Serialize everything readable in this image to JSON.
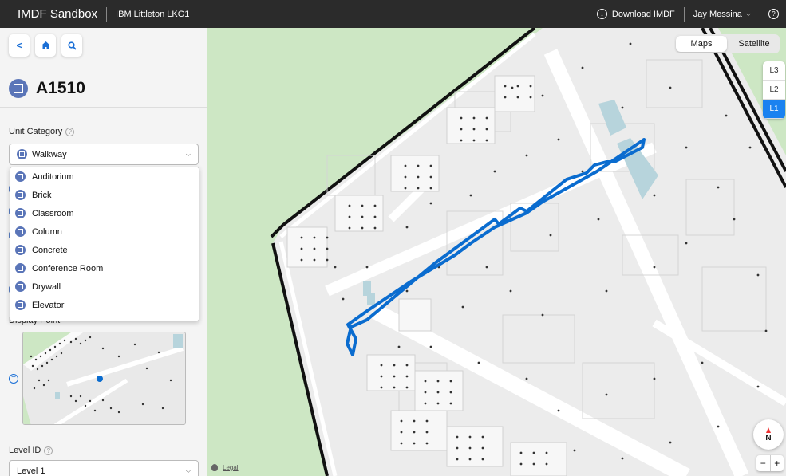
{
  "topbar": {
    "app_title": "IMDF Sandbox",
    "venue": "IBM Littleton LKG1",
    "download_label": "Download IMDF",
    "user_name": "Jay Messina",
    "help_glyph": "?"
  },
  "sidebar": {
    "unit_name": "A1510",
    "unit_category_label": "Unit Category",
    "unit_category_value": "Walkway",
    "categories": [
      "Auditorium",
      "Brick",
      "Classroom",
      "Column",
      "Concrete",
      "Conference Room",
      "Drywall",
      "Elevator"
    ],
    "display_point_label": "Display Point",
    "level_id_label": "Level ID",
    "level_value": "Level 1"
  },
  "map": {
    "view_modes": [
      "Maps",
      "Satellite"
    ],
    "active_view": "Maps",
    "levels": [
      "L3",
      "L2",
      "L1"
    ],
    "active_level": "L1",
    "compass_label": "N",
    "zoom_out": "−",
    "zoom_in": "+",
    "legal_label": "Legal"
  },
  "colors": {
    "accent": "#1a82f0",
    "selection": "#0a6ccf",
    "grass": "#cde7c4",
    "floor": "#ececec",
    "topbar": "#2b2b2b",
    "category_icon": "#5a75b8"
  },
  "icons": [
    "back-chevron-icon",
    "home-icon",
    "search-icon",
    "download-icon",
    "help-icon",
    "question-icon",
    "compass-icon",
    "apple-icon"
  ]
}
